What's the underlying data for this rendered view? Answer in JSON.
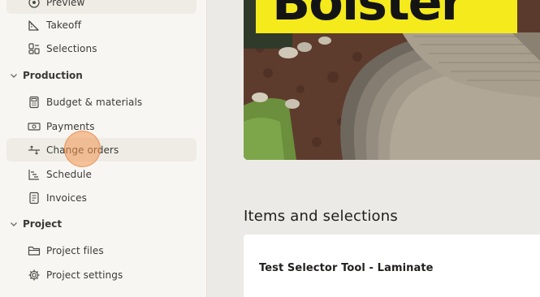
{
  "sidebar": {
    "items_top": [
      {
        "label": "Preview",
        "icon": "eye-icon"
      },
      {
        "label": "Takeoff",
        "icon": "ruler-icon"
      },
      {
        "label": "Selections",
        "icon": "selections-icon"
      }
    ],
    "production": {
      "label": "Production",
      "items": [
        {
          "label": "Budget & materials",
          "icon": "calculator-icon"
        },
        {
          "label": "Payments",
          "icon": "money-icon"
        },
        {
          "label": "Change orders",
          "icon": "change-orders-icon"
        },
        {
          "label": "Schedule",
          "icon": "schedule-icon"
        },
        {
          "label": "Invoices",
          "icon": "invoice-icon"
        }
      ]
    },
    "project": {
      "label": "Project",
      "items": [
        {
          "label": "Project files",
          "icon": "folder-icon"
        },
        {
          "label": "Project settings",
          "icon": "gear-icon"
        }
      ]
    }
  },
  "main": {
    "hero": {
      "brand_text": "Bolster",
      "brand_color": "#f5ea1c"
    },
    "items_title": "Items and selections",
    "card_title": "Test Selector Tool - Laminate"
  }
}
